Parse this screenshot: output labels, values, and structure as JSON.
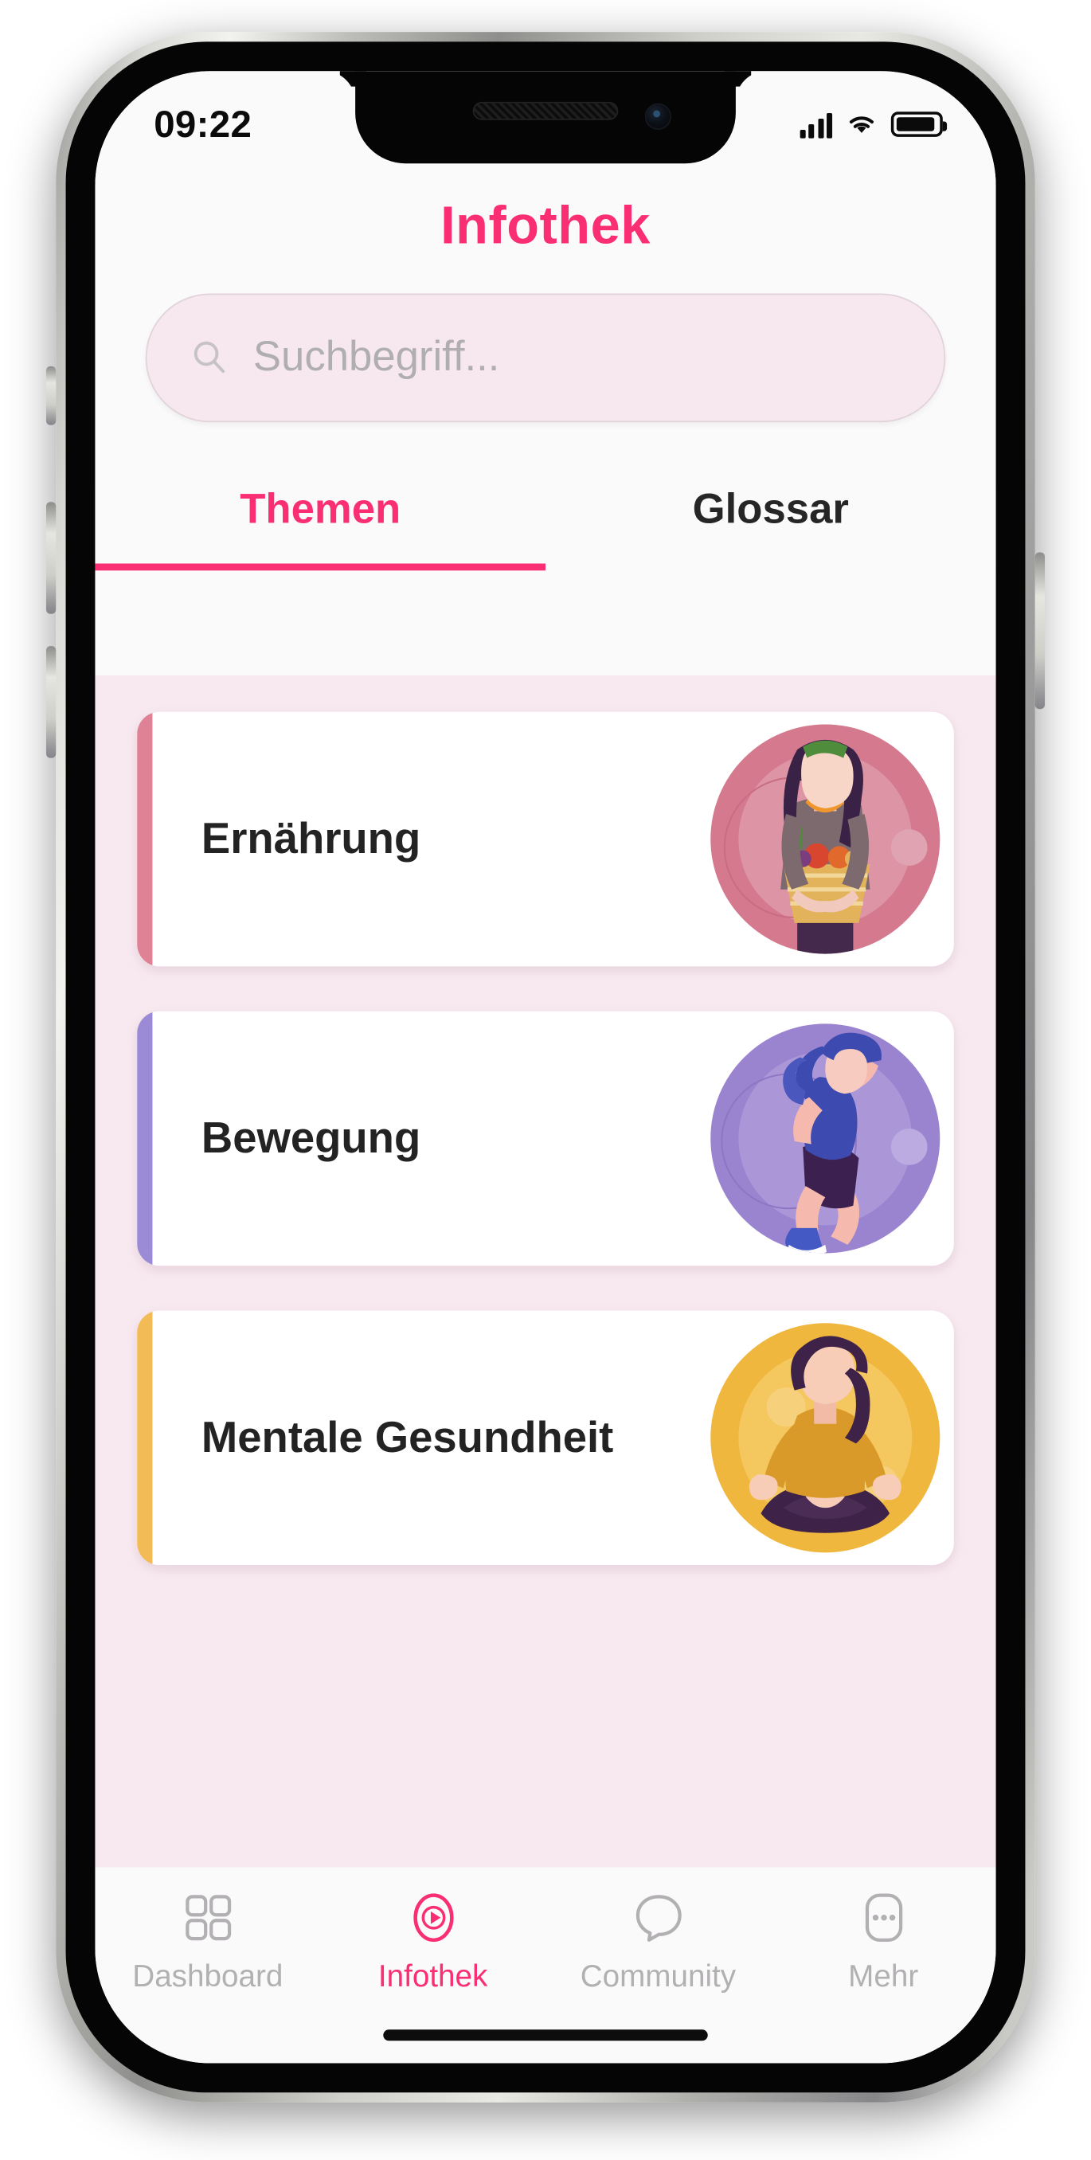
{
  "status_bar": {
    "time": "09:22",
    "signal_icon": "cellular-signal-icon",
    "wifi_icon": "wifi-icon",
    "battery_icon": "battery-icon",
    "battery_level": "92"
  },
  "header": {
    "title": "Infothek",
    "title_color": "#fa2e72"
  },
  "search": {
    "icon": "search-icon",
    "placeholder": "Suchbegriff...",
    "value": ""
  },
  "tabs": [
    {
      "label": "Themen",
      "active": true
    },
    {
      "label": "Glossar",
      "active": false
    }
  ],
  "topics": [
    {
      "title": "Ernährung",
      "accent": "#e08296",
      "art": "woman-holding-vegetable-basket-illustration",
      "circle_color": "#d4798e"
    },
    {
      "title": "Bewegung",
      "accent": "#9b8ad6",
      "art": "woman-running-illustration",
      "circle_color": "#9b84cf"
    },
    {
      "title": "Mentale Gesundheit",
      "accent": "#f3bb55",
      "art": "woman-meditating-lotus-illustration",
      "circle_color": "#f0b73f"
    }
  ],
  "bottom_nav": [
    {
      "label": "Dashboard",
      "icon": "grid-squares-icon",
      "active": false
    },
    {
      "label": "Infothek",
      "icon": "play-circle-icon",
      "active": true
    },
    {
      "label": "Community",
      "icon": "speech-bubble-icon",
      "active": false
    },
    {
      "label": "Mehr",
      "icon": "more-dots-icon",
      "active": false
    }
  ],
  "colors": {
    "accent_pink": "#fa2e72",
    "content_bg": "#f8e9f0",
    "screen_bg": "#fafafa",
    "search_bg": "#f7e8ef",
    "inactive_gray": "#b2b0b2"
  }
}
